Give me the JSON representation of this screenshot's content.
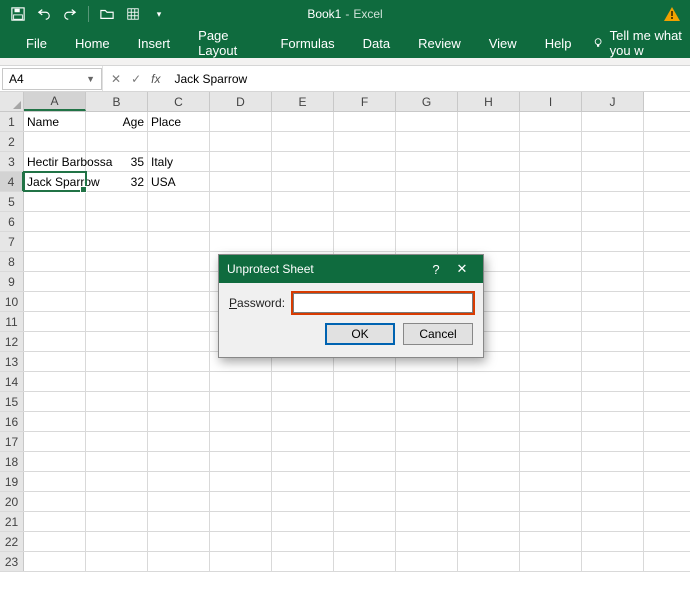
{
  "titlebar": {
    "book": "Book1",
    "app": "Excel"
  },
  "ribbon": {
    "tabs": [
      "File",
      "Home",
      "Insert",
      "Page Layout",
      "Formulas",
      "Data",
      "Review",
      "View",
      "Help"
    ],
    "tellme": "Tell me what you w"
  },
  "namebox": {
    "ref": "A4"
  },
  "formula_bar": {
    "value": "Jack Sparrow",
    "fx": "fx",
    "cancel": "✕",
    "enter": "✓"
  },
  "columns": [
    "A",
    "B",
    "C",
    "D",
    "E",
    "F",
    "G",
    "H",
    "I",
    "J"
  ],
  "rows_count": 23,
  "active": {
    "col": "A",
    "row": 4
  },
  "sheet": {
    "1": {
      "A": "Name",
      "B": "Age",
      "C": "Place"
    },
    "3": {
      "A": "Hectir Barbossa",
      "B": "35",
      "C": "Italy"
    },
    "4": {
      "A": "Jack Sparrow",
      "B": "32",
      "C": "USA"
    }
  },
  "dialog": {
    "title": "Unprotect Sheet",
    "help": "?",
    "close": "✕",
    "label_prefix": "P",
    "label_rest": "assword:",
    "value": "",
    "ok": "OK",
    "cancel": "Cancel"
  }
}
